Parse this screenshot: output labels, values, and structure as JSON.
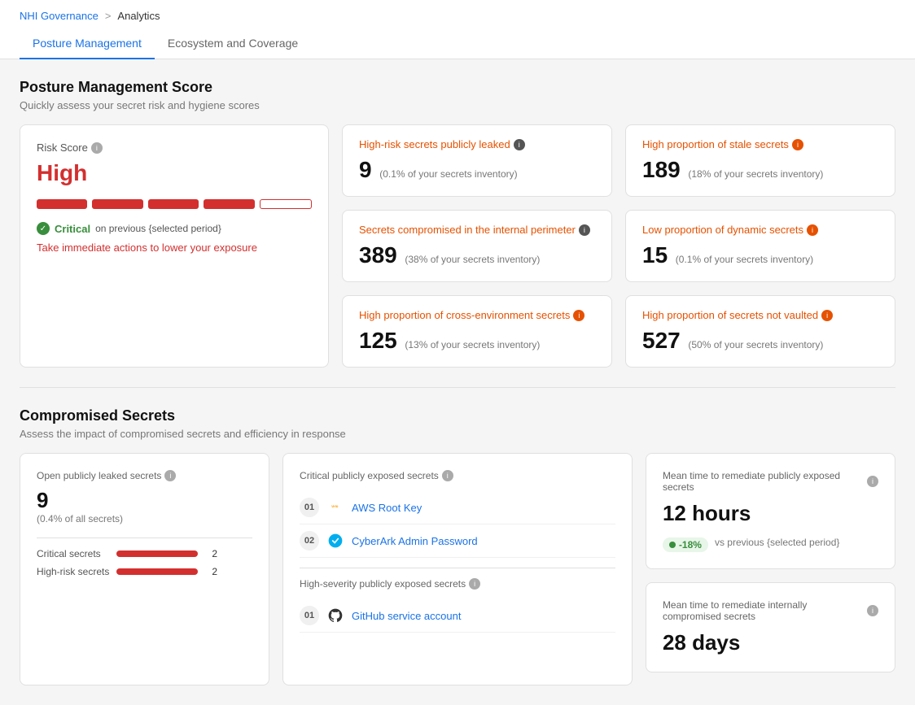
{
  "breadcrumb": {
    "parent": "NHI Governance",
    "separator": ">",
    "current": "Analytics"
  },
  "tabs": [
    {
      "id": "posture",
      "label": "Posture Management",
      "active": true
    },
    {
      "id": "ecosystem",
      "label": "Ecosystem and Coverage",
      "active": false
    }
  ],
  "posture_section": {
    "title": "Posture Management Score",
    "subtitle": "Quickly assess your secret risk and hygiene scores"
  },
  "risk_card": {
    "label": "Risk Score",
    "value": "High",
    "bars_filled": 4,
    "bars_total": 5,
    "status_label": "Critical",
    "status_period": "on previous {selected period}",
    "action_text": "Take immediate actions to lower your exposure"
  },
  "metrics": [
    {
      "id": "high_risk_leaked",
      "title": "High-risk secrets publicly leaked",
      "value": "9",
      "sub": "(0.1% of your secrets inventory)",
      "color": "orange",
      "info": "dark"
    },
    {
      "id": "stale_secrets",
      "title": "High proportion of stale secrets",
      "value": "189",
      "sub": "(18% of your secrets inventory)",
      "color": "orange",
      "info": "orange"
    },
    {
      "id": "compromised_internal",
      "title": "Secrets compromised in the internal perimeter",
      "value": "389",
      "sub": "(38% of your secrets inventory)",
      "color": "orange",
      "info": "dark"
    },
    {
      "id": "low_dynamic",
      "title": "Low proportion of dynamic secrets",
      "value": "15",
      "sub": "(0.1% of your secrets inventory)",
      "color": "orange",
      "info": "orange"
    },
    {
      "id": "cross_env",
      "title": "High proportion of cross-environment secrets",
      "value": "125",
      "sub": "(13% of your secrets inventory)",
      "color": "orange",
      "info": "orange"
    },
    {
      "id": "not_vaulted",
      "title": "High proportion of  secrets not vaulted",
      "value": "527",
      "sub": "(50% of your secrets inventory)",
      "color": "orange",
      "info": "orange"
    }
  ],
  "compromised_section": {
    "title": "Compromised Secrets",
    "subtitle": "Assess the impact of compromised secrets and efficiency in response"
  },
  "open_secrets": {
    "label": "Open publicly leaked secrets",
    "value": "9",
    "sub": "(0.4% of all secrets)",
    "critical_label": "Critical secrets",
    "critical_value": "2",
    "high_risk_label": "High-risk secrets",
    "high_risk_value": "2"
  },
  "critical_exposed": {
    "label": "Critical publicly exposed secrets",
    "items": [
      {
        "num": "01",
        "icon": "aws",
        "name": "AWS Root Key"
      },
      {
        "num": "02",
        "icon": "cyberark",
        "name": "CyberArk Admin Password"
      }
    ],
    "high_severity_label": "High-severity publicly exposed secrets",
    "high_severity_items": [
      {
        "num": "01",
        "icon": "github",
        "name": "GitHub service account"
      }
    ]
  },
  "mtr_public": {
    "label": "Mean time to remediate publicly exposed secrets",
    "value": "12 hours",
    "badge": "-18%",
    "badge_vs": "vs previous {selected period}"
  },
  "mtr_internal": {
    "label": "Mean time to remediate internally compromised secrets",
    "value": "28 days"
  }
}
